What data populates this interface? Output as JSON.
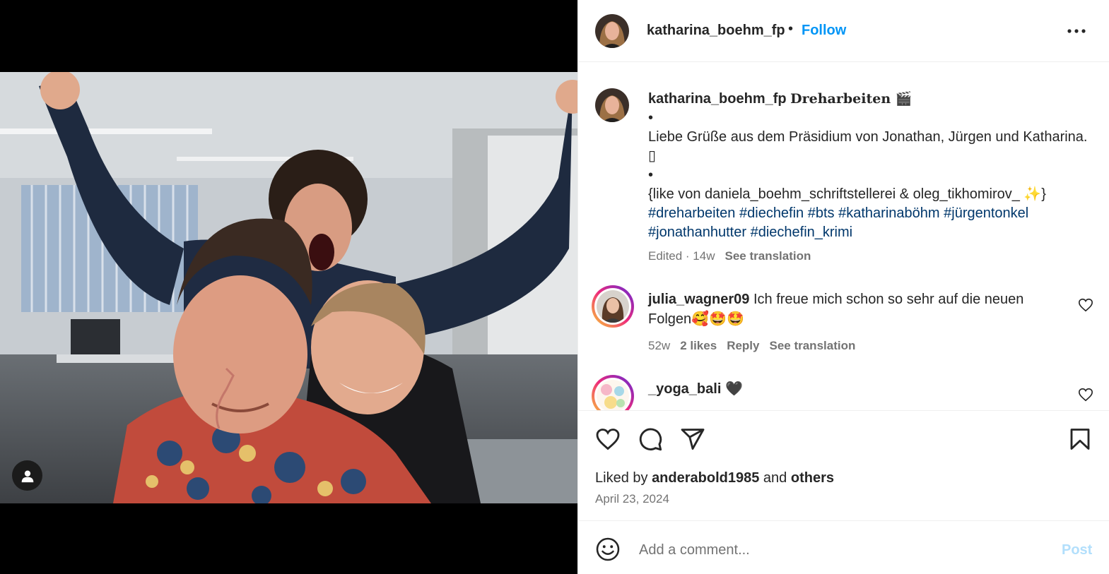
{
  "colors": {
    "accent": "#0095f6",
    "hashtag": "#00376b",
    "muted": "#737373",
    "post_disabled": "#b2dffc"
  },
  "header": {
    "username": "katharina_boehm_fp",
    "separator": "•",
    "follow_label": "Follow",
    "more_icon": "more-horizontal-icon"
  },
  "caption": {
    "username": "katharina_boehm_fp",
    "title": "Dreharbeiten 🎬",
    "bullet1": "•",
    "text": "Liebe Grüße aus dem Präsidium von Jonathan, Jürgen und Katharina. ▯",
    "bullet2": "•",
    "likes_note": "{like von daniela_boehm_schriftstellerei & oleg_tikhomirov_ ✨}",
    "hashtags": [
      "#dreharbeiten",
      "#diechefin",
      "#bts",
      "#katharinaböhm",
      "#jürgentonkel",
      "#jonathanhutter",
      "#diechefin_krimi"
    ],
    "edited": "Edited · 14w",
    "see_translation": "See translation"
  },
  "comments": [
    {
      "username": "julia_wagner09",
      "text": "Ich freue mich schon so sehr auf die neuen Folgen🥰🤩🤩",
      "age": "52w",
      "likes": "2 likes",
      "reply": "Reply",
      "see_translation": "See translation"
    },
    {
      "username": "_yoga_bali",
      "text": "🖤"
    }
  ],
  "actions": {
    "like_icon": "heart-icon",
    "comment_icon": "comment-icon",
    "share_icon": "send-icon",
    "save_icon": "bookmark-icon"
  },
  "likes": {
    "prefix": "Liked by",
    "user": "anderabold1985",
    "middle": "and",
    "others": "others"
  },
  "date": "April 23, 2024",
  "add_comment": {
    "placeholder": "Add a comment...",
    "post_label": "Post",
    "emoji_icon": "emoji-icon"
  },
  "media": {
    "tag_icon": "user-tag-icon"
  }
}
